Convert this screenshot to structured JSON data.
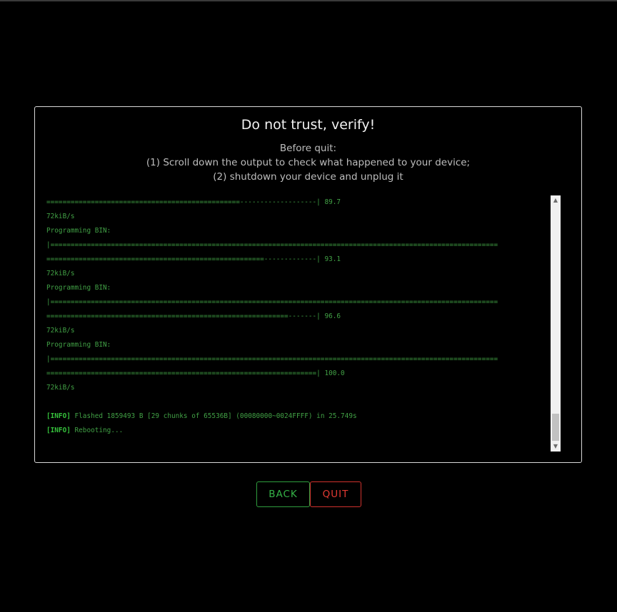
{
  "dialog": {
    "title": "Do not trust, verify!",
    "subtitle_1": "Before quit:",
    "subtitle_2": "(1) Scroll down the output to check what happened to your device;",
    "subtitle_3": "(2) shutdown your device and unplug it"
  },
  "log": {
    "lines": [
      {
        "text": "================================================-------------------| 89.7"
      },
      {
        "text": "72kiB/s"
      },
      {
        "text": "Programming BIN:"
      },
      {
        "text": "|==============================================================================================================="
      },
      {
        "text": "======================================================-------------| 93.1"
      },
      {
        "text": "72kiB/s"
      },
      {
        "text": "Programming BIN:"
      },
      {
        "text": "|==============================================================================================================="
      },
      {
        "text": "============================================================-------| 96.6"
      },
      {
        "text": "72kiB/s"
      },
      {
        "text": "Programming BIN:"
      },
      {
        "text": "|==============================================================================================================="
      },
      {
        "text": "===================================================================| 100.0"
      },
      {
        "text": "72kiB/s"
      },
      {
        "text": ""
      },
      {
        "tag": "[INFO]",
        "text": " Flashed 1859493 B [29 chunks of 65536B] (00080000~0024FFFF) in 25.749s"
      },
      {
        "tag": "[INFO]",
        "text": " Rebooting..."
      }
    ]
  },
  "scrollbar": {
    "up_icon": "scroll-up-arrow-icon",
    "down_icon": "scroll-down-arrow-icon"
  },
  "buttons": {
    "back_label": "BACK",
    "quit_label": "QUIT"
  },
  "colors": {
    "log_text": "#41a045",
    "back_accent": "#35b347",
    "quit_accent": "#e23a33"
  }
}
